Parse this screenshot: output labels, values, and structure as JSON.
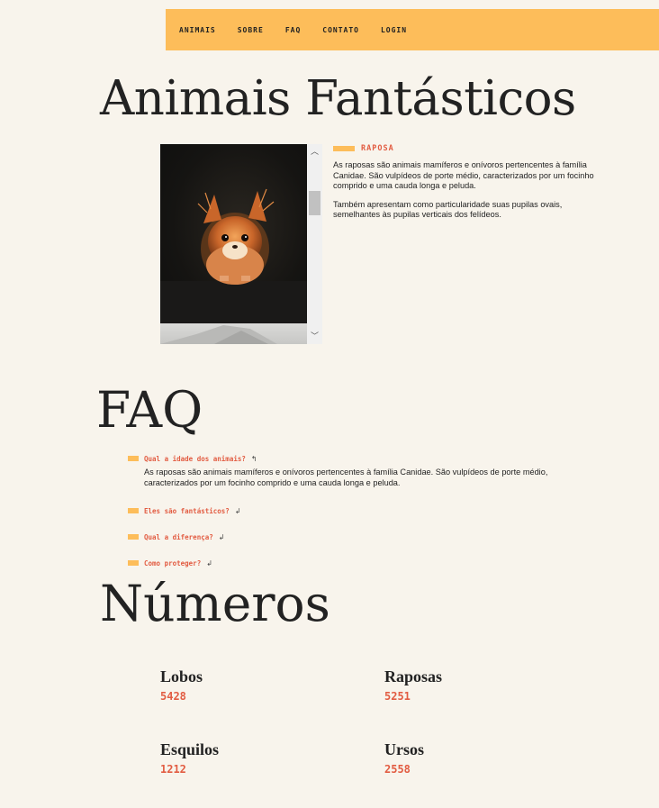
{
  "nav": {
    "items": [
      "ANIMAIS",
      "SOBRE",
      "FAQ",
      "CONTATO",
      "LOGIN"
    ]
  },
  "title": "Animais Fantásticos",
  "animal": {
    "tag": "RAPOSA",
    "paragraphs": [
      "As raposas são animais mamíferos e onívoros pertencentes à família Canidae. São vulpídeos de porte médio, caracterizados por um focinho comprido e uma cauda longa e peluda.",
      "Também apresentam como particularidade suas pupilas ovais, semelhantes às pupilas verticais dos felídeos."
    ]
  },
  "faq": {
    "title": "FAQ",
    "items": [
      {
        "question": "Qual a idade dos animais?",
        "arrow": "↰",
        "answer": "As raposas são animais mamíferos e onívoros pertencentes à família Canidae. São vulpídeos de porte médio, caracterizados por um focinho comprido e uma cauda longa e peluda.",
        "open": true
      },
      {
        "question": "Eles são fantásticos?",
        "arrow": "↲",
        "open": false
      },
      {
        "question": "Qual a diferença?",
        "arrow": "↲",
        "open": false
      },
      {
        "question": "Como proteger?",
        "arrow": "↲",
        "open": false
      }
    ]
  },
  "numbers": {
    "title": "Números",
    "stats": [
      {
        "name": "Lobos",
        "value": "5428"
      },
      {
        "name": "Raposas",
        "value": "5251"
      },
      {
        "name": "Esquilos",
        "value": "1212"
      },
      {
        "name": "Ursos",
        "value": "2558"
      }
    ]
  },
  "colors": {
    "background": "#f8f4ec",
    "accent": "#fdbd5a",
    "highlight": "#e25c42"
  }
}
